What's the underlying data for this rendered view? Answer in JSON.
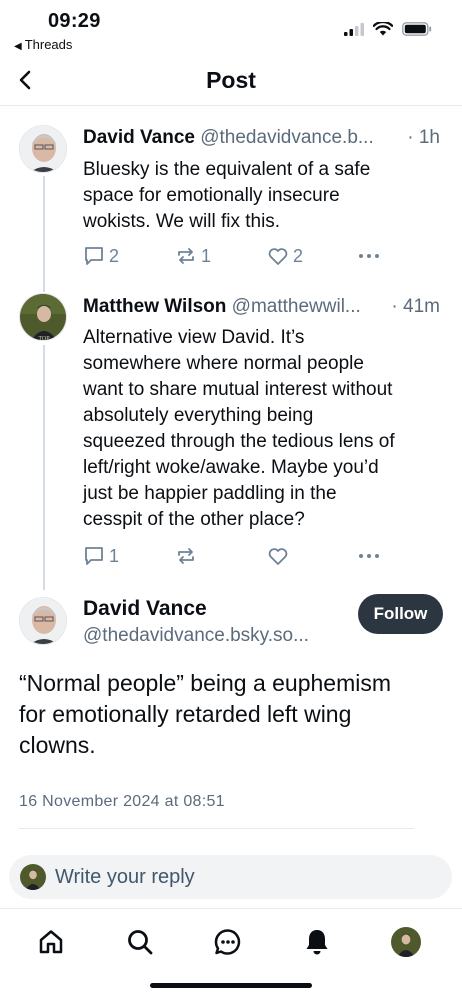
{
  "status_bar": {
    "time": "09:29",
    "back_app": "Threads"
  },
  "header": {
    "title": "Post"
  },
  "thread": [
    {
      "author_name": "David Vance",
      "author_handle": "@thedavidvance.b...",
      "time": "· 1h",
      "text_lines": [
        "Bluesky is the equivalent of a safe",
        "space for emotionally insecure",
        "wokists. We will fix this."
      ],
      "replies": "2",
      "reposts": "1",
      "likes": "2"
    },
    {
      "author_name": "Matthew Wilson",
      "author_handle": "@matthewwil...",
      "time": "· 41m",
      "text_lines": [
        "Alternative view David. It’s",
        "somewhere where normal people",
        "want to share mutual interest without",
        "absolutely everything being",
        "squeezed through the tedious lens of",
        "left/right woke/awake. Maybe you’d",
        "just be happier paddling in the",
        "cesspit of the other place?"
      ],
      "replies": "1",
      "reposts": "",
      "likes": ""
    }
  ],
  "main_post": {
    "author_name": "David Vance",
    "author_handle": "@thedavidvance.bsky.so...",
    "follow_label": "Follow",
    "text_lines": [
      "“Normal people” being a euphemism",
      "for emotionally retarded left wing",
      "clowns."
    ],
    "date": "16 November 2024 at 08:51"
  },
  "reply": {
    "placeholder": "Write your reply"
  },
  "bottom_nav": {
    "items": [
      "home-icon",
      "search-icon",
      "chat-icon",
      "bell-icon",
      "profile-avatar"
    ]
  },
  "colors": {
    "follow_bg": "#2b3640",
    "muted": "#5b6b7c",
    "action_icon": "#6f8296"
  }
}
